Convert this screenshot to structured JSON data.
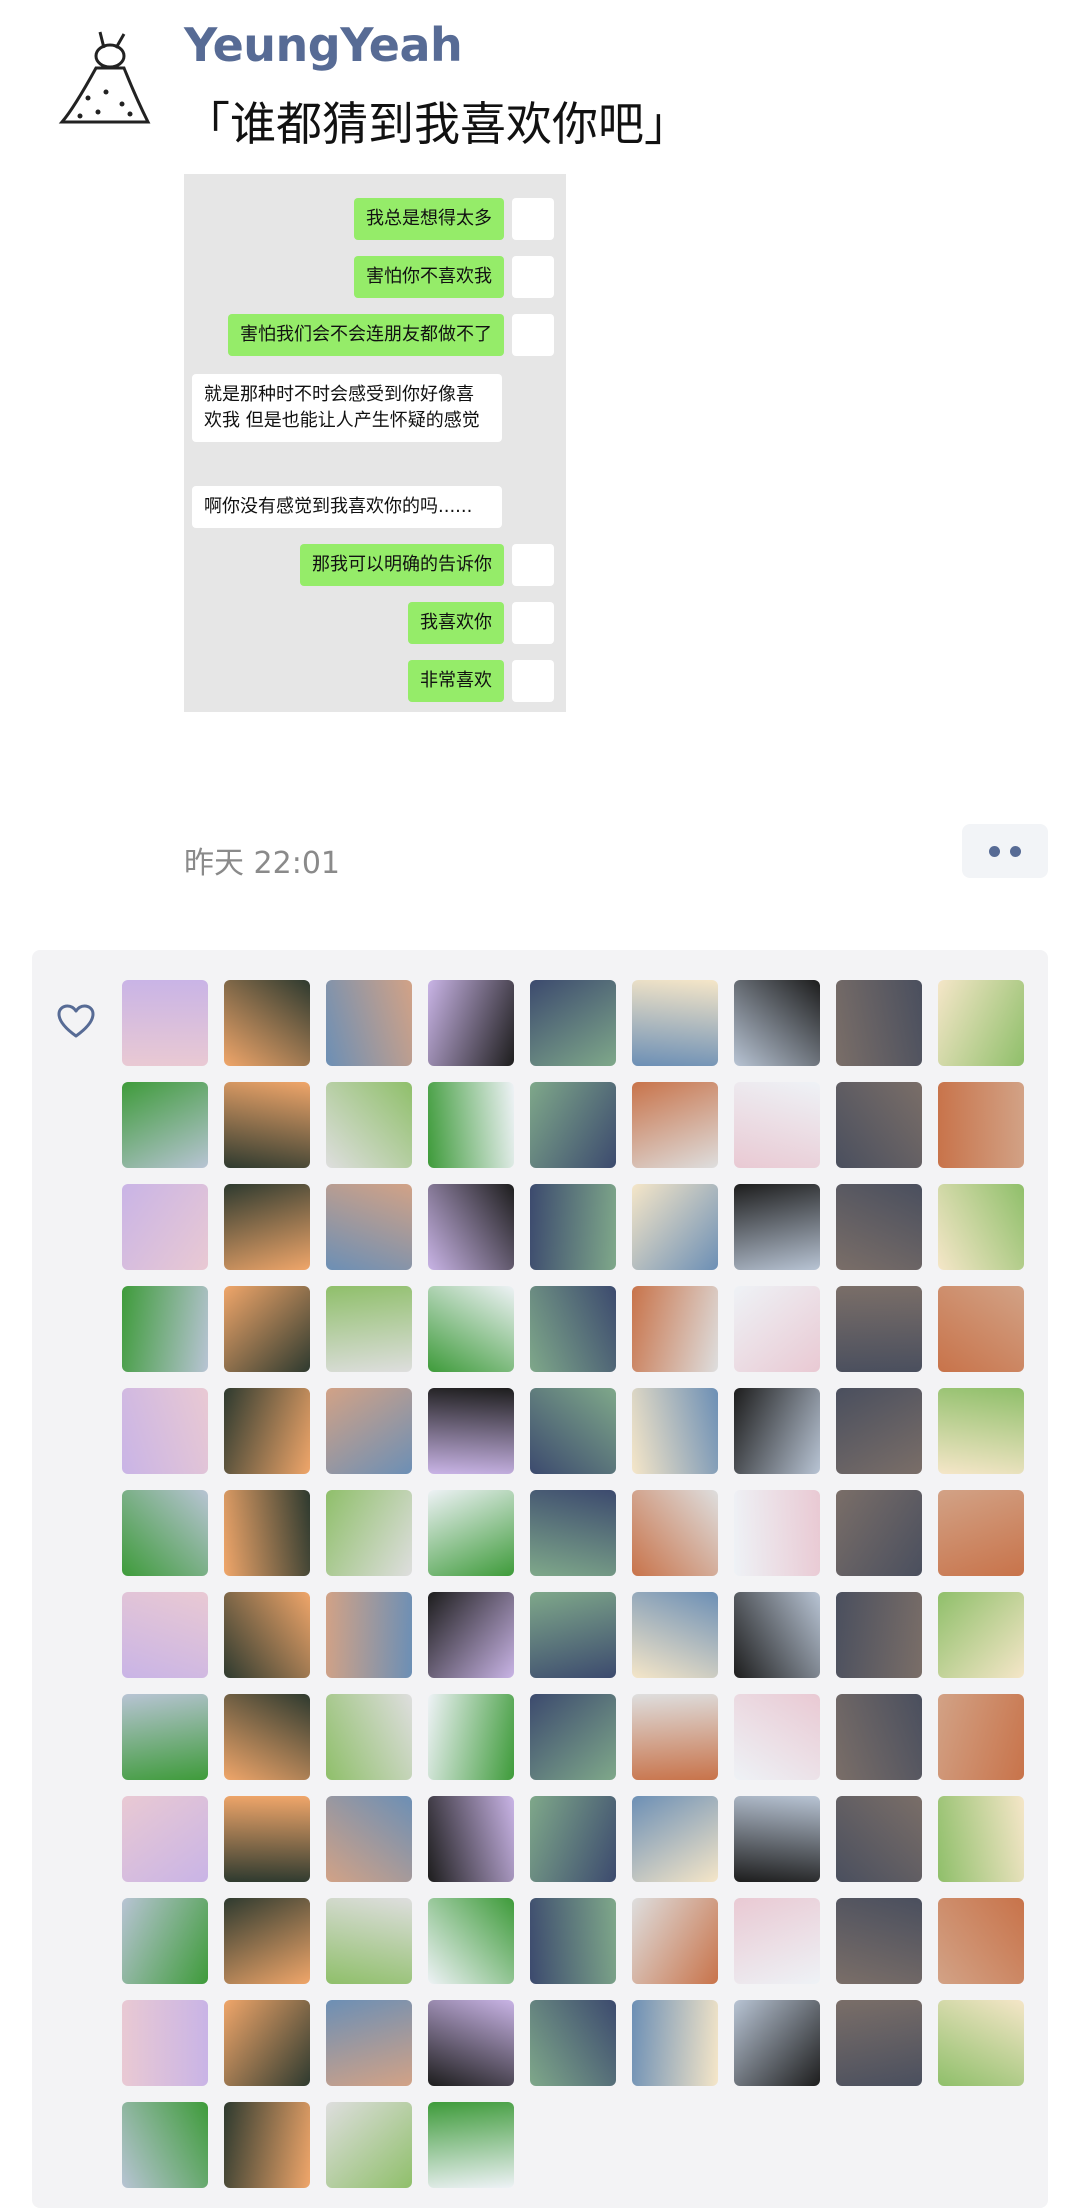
{
  "post": {
    "username": "YeungYeah",
    "text": "「谁都猜到我喜欢你吧」",
    "timestamp": "昨天 22:01"
  },
  "chat_screenshot": {
    "messages": [
      {
        "from": "me",
        "text": "我总是想得太多"
      },
      {
        "from": "me",
        "text": "害怕你不喜欢我"
      },
      {
        "from": "me",
        "text": "害怕我们会不会连朋友都做不了"
      },
      {
        "from": "them",
        "text": "就是那种时不时会感受到你好像喜欢我 但是也能让人产生怀疑的感觉"
      },
      {
        "from": "them",
        "text": "啊你没有感觉到我喜欢你的吗......"
      },
      {
        "from": "me",
        "text": "那我可以明确的告诉你"
      },
      {
        "from": "me",
        "text": "我喜欢你"
      },
      {
        "from": "me",
        "text": "非常喜欢"
      }
    ]
  },
  "likes": {
    "icon": "heart-outline-icon",
    "count": 103
  },
  "colors": {
    "name": "#576b95",
    "my_bubble": "#95ec69",
    "their_bubble": "#ffffff",
    "panel": "#f3f3f5",
    "timestamp": "#8a8a8a"
  }
}
